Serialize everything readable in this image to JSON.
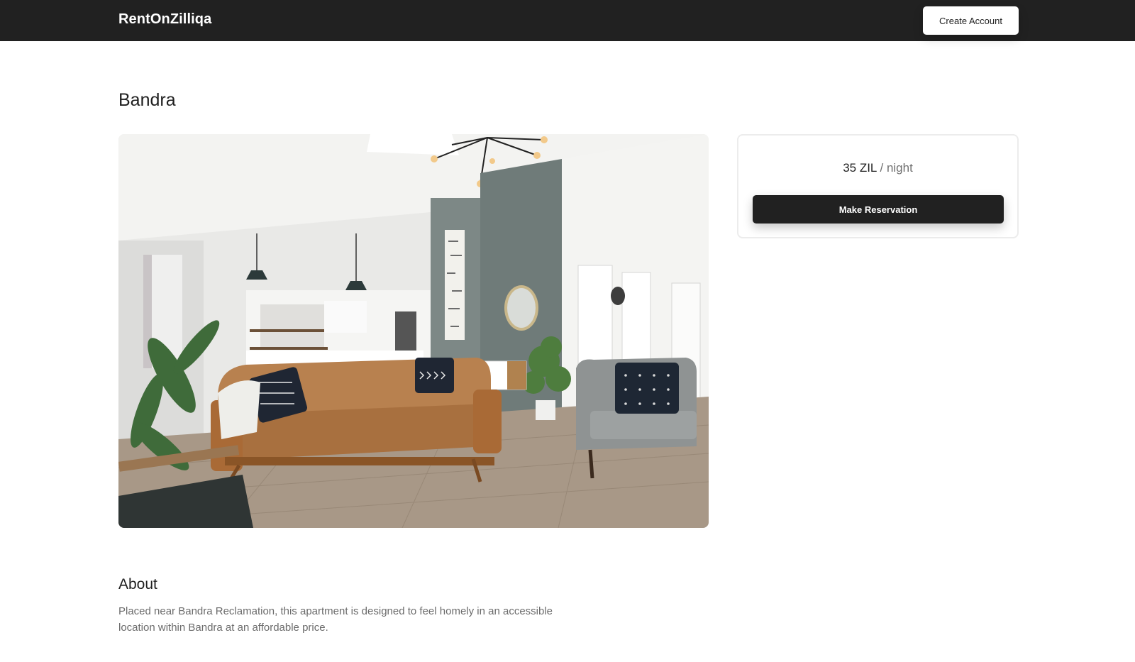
{
  "navbar": {
    "brand": "RentOnZilliqa",
    "create_account_label": "Create Account"
  },
  "listing": {
    "title": "Bandra",
    "photo_icon": "living-room-photo"
  },
  "booking": {
    "price": "35 ZIL",
    "unit": "/ night",
    "reserve_label": "Make Reservation"
  },
  "about": {
    "heading": "About",
    "text": "Placed near Bandra Reclamation, this apartment is designed to feel homely in an accessible location within Bandra at an affordable price."
  },
  "colors": {
    "navbar_bg": "#212121",
    "button_dark": "#212121",
    "text_muted": "#6b6b6b"
  }
}
